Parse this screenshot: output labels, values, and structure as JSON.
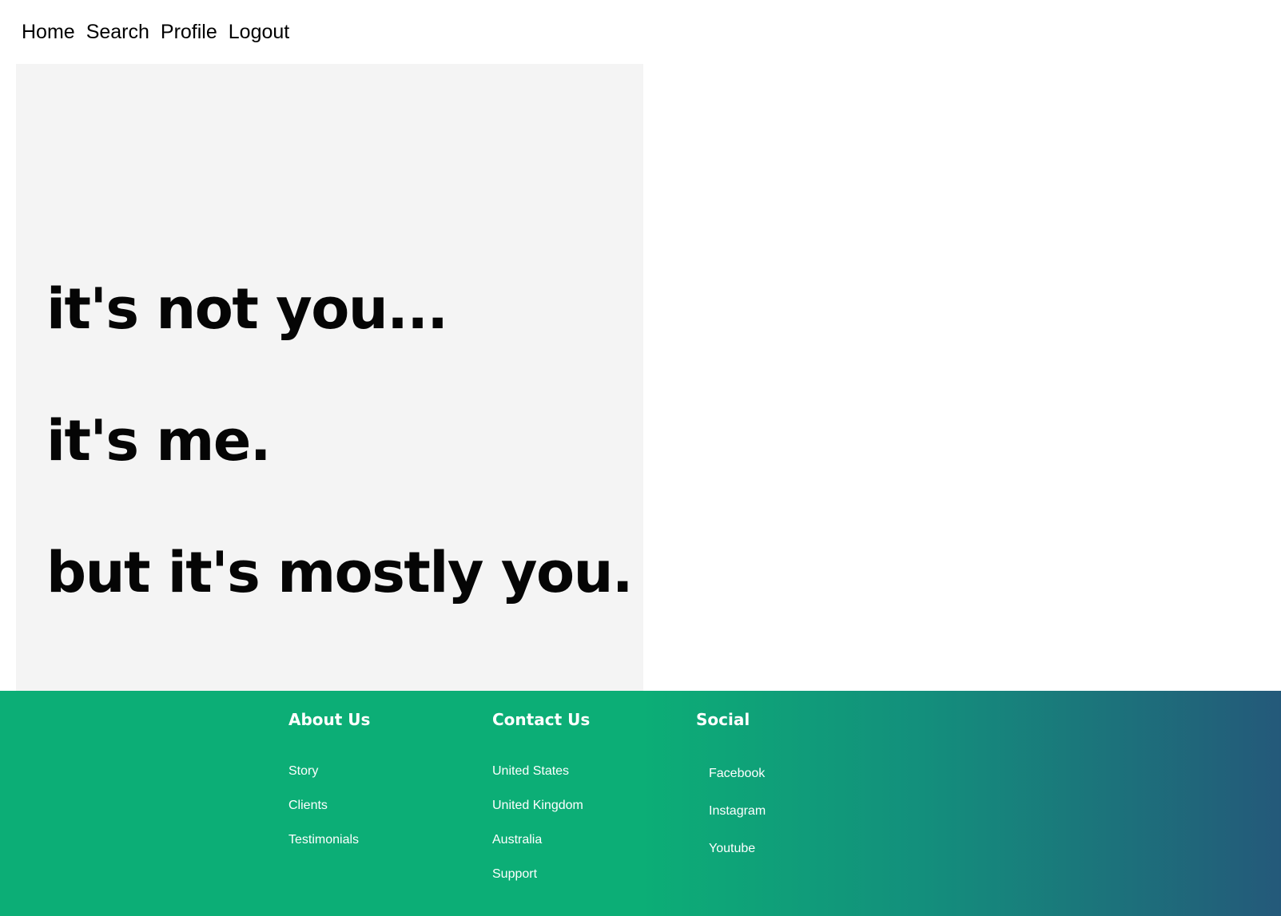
{
  "nav": {
    "items": [
      "Home",
      "Search",
      "Profile",
      "Logout"
    ]
  },
  "hero": {
    "lines": [
      "it's not you...",
      "it's me.",
      "but it's mostly you."
    ],
    "background": "#f4f4f4"
  },
  "footer": {
    "colors": {
      "green": "#0cae76",
      "blue": "#24597a",
      "text": "#ffffff"
    },
    "about": {
      "heading": "About Us",
      "links": [
        "Story",
        "Clients",
        "Testimonials"
      ]
    },
    "contact": {
      "heading": "Contact Us",
      "links": [
        "United States",
        "United Kingdom",
        "Australia",
        "Support"
      ]
    },
    "social": {
      "heading": "Social",
      "links": [
        "Facebook",
        "Instagram",
        "Youtube"
      ]
    }
  }
}
